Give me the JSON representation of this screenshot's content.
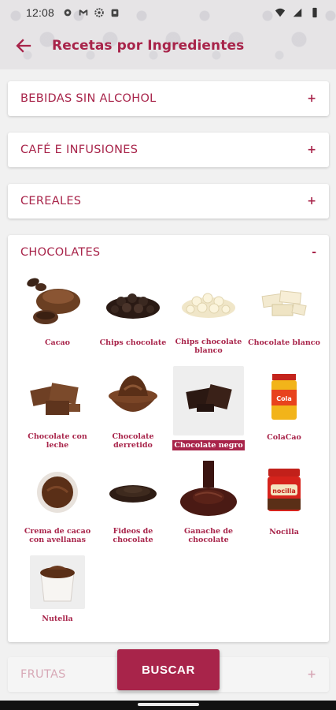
{
  "status": {
    "time": "12:08"
  },
  "appbar": {
    "title": "Recetas por Ingredientes"
  },
  "sections": [
    {
      "title": "BEBIDAS SIN ALCOHOL",
      "toggle": "+"
    },
    {
      "title": "CAFÉ E INFUSIONES",
      "toggle": "+"
    },
    {
      "title": "CEREALES",
      "toggle": "+"
    },
    {
      "title": "CHOCOLATES",
      "toggle": "-"
    },
    {
      "title": "FRUTAS",
      "toggle": "+"
    }
  ],
  "chocolates": {
    "items": [
      {
        "label": "Cacao",
        "icon": "cacao-icon"
      },
      {
        "label": "Chips chocolate",
        "icon": "chips-chocolate-icon"
      },
      {
        "label": "Chips chocolate blanco",
        "icon": "chips-white-chocolate-icon"
      },
      {
        "label": "Chocolate blanco",
        "icon": "white-chocolate-icon"
      },
      {
        "label": "Chocolate con leche",
        "icon": "milk-chocolate-icon"
      },
      {
        "label": "Chocolate derretido",
        "icon": "melted-chocolate-icon"
      },
      {
        "label": "Chocolate negro",
        "icon": "dark-chocolate-icon",
        "selected": true
      },
      {
        "label": "ColaCao",
        "icon": "colacao-jar-icon"
      },
      {
        "label": "Crema de cacao con avellanas",
        "icon": "cocoa-cream-icon"
      },
      {
        "label": "Fideos de chocolate",
        "icon": "chocolate-sprinkles-icon"
      },
      {
        "label": "Ganache de chocolate",
        "icon": "ganache-icon"
      },
      {
        "label": "Nocilla",
        "icon": "nocilla-jar-icon"
      },
      {
        "label": "Nutella",
        "icon": "nutella-jar-icon"
      }
    ]
  },
  "buscar_label": "BUSCAR",
  "colors": {
    "accent": "#a8244a",
    "background": "#f1f1f1"
  }
}
